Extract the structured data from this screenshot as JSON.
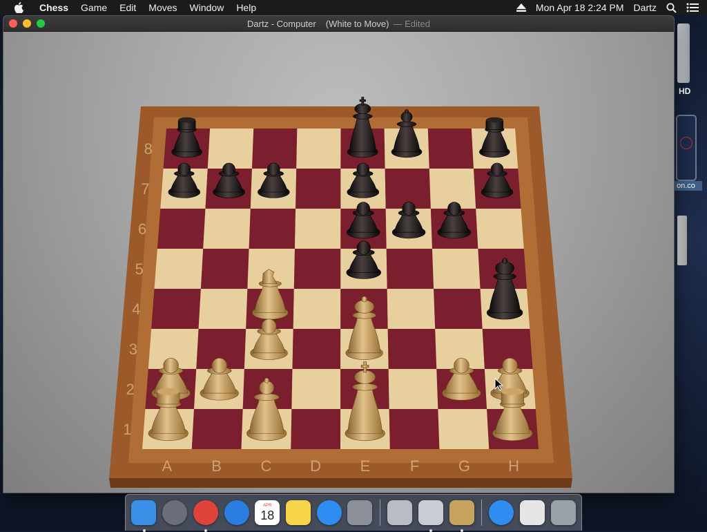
{
  "menubar": {
    "app_name": "Chess",
    "items": [
      "Game",
      "Edit",
      "Moves",
      "Window",
      "Help"
    ],
    "clock": "Mon Apr 18  2:24 PM",
    "user": "Dartz",
    "icons": [
      "apple-icon",
      "eject-icon",
      "spotlight-search-icon",
      "notification-center-icon"
    ]
  },
  "window": {
    "title": "Dartz - Computer",
    "status": "(White to Move)",
    "edited": "— Edited"
  },
  "board": {
    "files": [
      "A",
      "B",
      "C",
      "D",
      "E",
      "F",
      "G",
      "H"
    ],
    "ranks": [
      "1",
      "2",
      "3",
      "4",
      "5",
      "6",
      "7",
      "8"
    ],
    "light_square": "#e8cf9e",
    "dark_square": "#7b1f2e",
    "frame": "#9c5a2b",
    "pieces": [
      {
        "color": "black",
        "type": "rook",
        "square": "a8"
      },
      {
        "color": "black",
        "type": "king",
        "square": "e8"
      },
      {
        "color": "black",
        "type": "bishop",
        "square": "f8"
      },
      {
        "color": "black",
        "type": "rook",
        "square": "h8"
      },
      {
        "color": "black",
        "type": "pawn",
        "square": "a7"
      },
      {
        "color": "black",
        "type": "pawn",
        "square": "b7"
      },
      {
        "color": "black",
        "type": "pawn",
        "square": "c7"
      },
      {
        "color": "black",
        "type": "pawn",
        "square": "e7"
      },
      {
        "color": "black",
        "type": "pawn",
        "square": "h7"
      },
      {
        "color": "black",
        "type": "pawn",
        "square": "e6"
      },
      {
        "color": "black",
        "type": "pawn",
        "square": "f6"
      },
      {
        "color": "black",
        "type": "pawn",
        "square": "g6"
      },
      {
        "color": "black",
        "type": "pawn",
        "square": "e5"
      },
      {
        "color": "black",
        "type": "queen",
        "square": "h4"
      },
      {
        "color": "white",
        "type": "knight",
        "square": "c4"
      },
      {
        "color": "white",
        "type": "pawn",
        "square": "c3"
      },
      {
        "color": "white",
        "type": "queen",
        "square": "e3"
      },
      {
        "color": "white",
        "type": "pawn",
        "square": "a2"
      },
      {
        "color": "white",
        "type": "pawn",
        "square": "b2"
      },
      {
        "color": "white",
        "type": "pawn",
        "square": "g2"
      },
      {
        "color": "white",
        "type": "pawn",
        "square": "h2"
      },
      {
        "color": "white",
        "type": "rook",
        "square": "a1"
      },
      {
        "color": "white",
        "type": "bishop",
        "square": "c1"
      },
      {
        "color": "white",
        "type": "king",
        "square": "e1"
      },
      {
        "color": "white",
        "type": "rook",
        "square": "h1"
      }
    ]
  },
  "desktop": {
    "disk_label": "HD",
    "file_label": "on.co"
  },
  "dock": {
    "items": [
      {
        "name": "finder-icon",
        "color": "#3a8ee6",
        "running": true
      },
      {
        "name": "launchpad-icon",
        "color": "#6b6f7a",
        "running": false
      },
      {
        "name": "chrome-icon",
        "color": "#e0433a",
        "running": true
      },
      {
        "name": "safari-icon",
        "color": "#2b7de0",
        "running": false
      },
      {
        "name": "calendar-icon",
        "color": "#ffffff",
        "running": false,
        "month": "APR",
        "day": "18"
      },
      {
        "name": "notes-icon",
        "color": "#f6d54a",
        "running": false
      },
      {
        "name": "app-store-icon",
        "color": "#2f8cf0",
        "running": false
      },
      {
        "name": "system-preferences-icon",
        "color": "#8a8f98",
        "running": false
      },
      {
        "name": "system-information-icon",
        "color": "#b9bcc2",
        "running": false
      },
      {
        "name": "instruments-icon",
        "color": "#c9ccd2",
        "running": true
      },
      {
        "name": "chess-icon",
        "color": "#c7a35f",
        "running": true
      },
      {
        "name": "app-store-downloads-icon",
        "color": "#2f8cf0",
        "running": false
      },
      {
        "name": "documents-icon",
        "color": "#e6e6e6",
        "running": false
      },
      {
        "name": "trash-icon",
        "color": "#9aa0a8",
        "running": false
      }
    ]
  }
}
